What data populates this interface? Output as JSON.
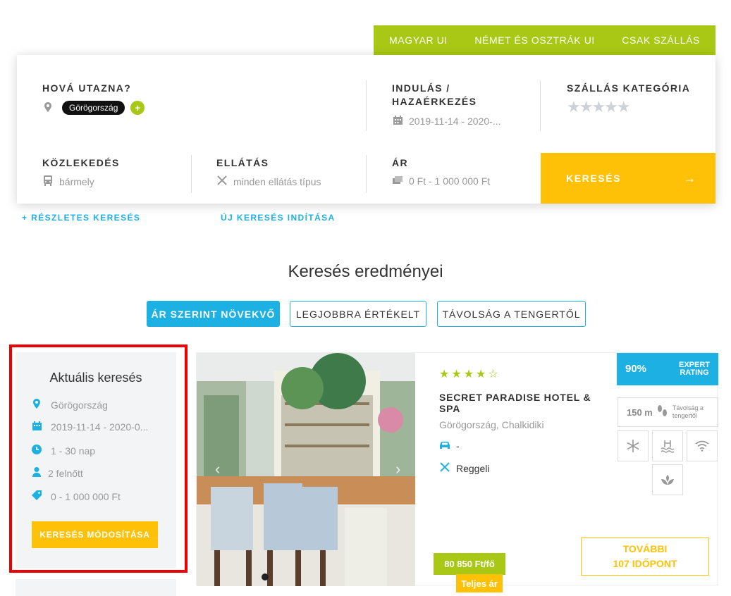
{
  "top_tabs": [
    "MAGYAR UI",
    "NÉMET ÉS OSZTRÁK UI",
    "CSAK SZÁLLÁS"
  ],
  "search": {
    "destination": {
      "label": "HOVÁ UTAZNA?",
      "chip": "Görögország",
      "add": "+"
    },
    "dates": {
      "label": "INDULÁS / HAZAÉRKEZÉS",
      "value": "2019-11-14 - 2020-..."
    },
    "category": {
      "label": "SZÁLLÁS KATEGÓRIA",
      "stars": "★★★★★"
    },
    "transport": {
      "label": "KÖZLEKEDÉS",
      "value": "bármely"
    },
    "board": {
      "label": "ELLÁTÁS",
      "value": "minden ellátás típus"
    },
    "price": {
      "label": "ÁR",
      "value": "0 Ft - 1 000 000 Ft"
    },
    "button": "KERESÉS",
    "button_arrow": "→"
  },
  "links": {
    "advanced": "+ RÉSZLETES KERESÉS",
    "new_search": "ÚJ KERESÉS INDÍTÁSA"
  },
  "results_title": "Keresés eredményei",
  "sort": [
    "ÁR SZERINT NÖVEKVŐ",
    "LEGJOBBRA ÉRTÉKELT",
    "TÁVOLSÁG A TENGERTŐL"
  ],
  "sidebar": {
    "title": "Aktuális keresés",
    "destination": "Görögország",
    "dates": "2019-11-14 - 2020-0...",
    "nights": "1 - 30 nap",
    "guests": "2 felnőtt",
    "price": "0 - 1 000 000 Ft",
    "modify_button": "KERESÉS MÓDOSÍTÁSA"
  },
  "hotel": {
    "stars": "★★★★☆",
    "name": "SECRET PARADISE HOTEL & SPA",
    "location": "Görögország, Chalkidiki",
    "transport": "-",
    "board": "Reggeli",
    "rating_pct": "90%",
    "rating_label_1": "EXPERT",
    "rating_label_2": "RATING",
    "distance": "150 m",
    "distance_label_1": "Távolság a",
    "distance_label_2": "tengertől",
    "price": "80 850 Ft/fő",
    "price_type": "Teljes ár",
    "more_1": "TOVÁBBI",
    "more_2": "107 IDŐPONT"
  },
  "colors": {
    "green": "#a9c815",
    "blue": "#1cb0e3",
    "yellow": "#ffc107",
    "highlight": "#ee0000"
  }
}
